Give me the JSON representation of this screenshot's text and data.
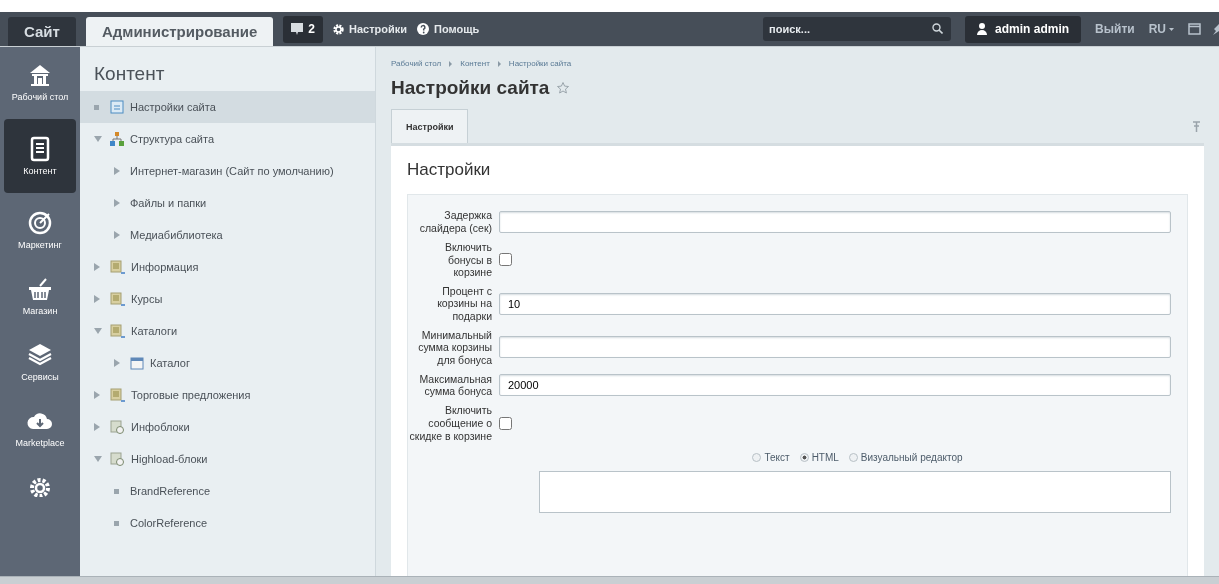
{
  "top_bar": {
    "tabs": [
      {
        "label": "Сайт",
        "selected": false
      },
      {
        "label": "Администрирование",
        "selected": true
      }
    ],
    "notifications": {
      "count": "2"
    },
    "links": [
      "Настройки",
      "Помощь"
    ],
    "search": {
      "placeholder": "поиск..."
    },
    "user": "admin admin",
    "logout": "Выйти",
    "language": "RU"
  },
  "nav": {
    "items": [
      {
        "label": "Рабочий стол",
        "selected": false
      },
      {
        "label": "Контент",
        "selected": true
      },
      {
        "label": "Маркетинг",
        "selected": false
      },
      {
        "label": "Магазин",
        "selected": false
      },
      {
        "label": "Сервисы",
        "selected": false
      },
      {
        "label": "Marketplace",
        "selected": false
      }
    ]
  },
  "tree": {
    "title": "Контент",
    "items": [
      {
        "label": "Настройки сайта",
        "kind": "page",
        "selected": true
      },
      {
        "label": "Структура сайта",
        "kind": "structure",
        "selected": false,
        "expanded": true,
        "children": [
          {
            "label": "Интернет-магазин (Сайт по умолчанию)",
            "kind": "plain",
            "selected": false,
            "expanded": false
          },
          {
            "label": "Файлы и папки",
            "kind": "plain",
            "selected": false,
            "expanded": false
          },
          {
            "label": "Медиабиблиотека",
            "kind": "plain",
            "selected": false,
            "expanded": false
          }
        ]
      },
      {
        "label": "Информация",
        "kind": "section",
        "selected": false,
        "expanded": false
      },
      {
        "label": "Курсы",
        "kind": "section",
        "selected": false,
        "expanded": false
      },
      {
        "label": "Каталоги",
        "kind": "section",
        "selected": false,
        "expanded": true,
        "children": [
          {
            "label": "Каталог",
            "kind": "catalog",
            "selected": false,
            "expanded": false
          }
        ]
      },
      {
        "label": "Торговые предложения",
        "kind": "section",
        "selected": false,
        "expanded": false
      },
      {
        "label": "Инфоблоки",
        "kind": "blocks",
        "selected": false,
        "expanded": false
      },
      {
        "label": "Highload-блоки",
        "kind": "blocks",
        "selected": false,
        "expanded": true,
        "children": [
          {
            "label": "BrandReference",
            "kind": "plain",
            "selected": false
          },
          {
            "label": "ColorReference",
            "kind": "plain",
            "selected": false
          }
        ]
      }
    ]
  },
  "main": {
    "breadcrumbs": [
      "Рабочий стол",
      "Контент",
      "Настройки сайта"
    ],
    "title": "Настройки сайта",
    "tabs": [
      {
        "label": "Настройки",
        "selected": true
      }
    ],
    "section_title": "Настройки",
    "fields": [
      {
        "kind": "text",
        "label": "Задержка слайдера (сек)"
      },
      {
        "kind": "checkbox",
        "label": "Включить бонусы в корзине",
        "checked": false
      },
      {
        "kind": "text",
        "label": "Процент с корзины на подарки",
        "value": "10"
      },
      {
        "kind": "text",
        "label": "Минимальный сумма корзины для бонуса"
      },
      {
        "kind": "text",
        "label": "Максимальная сумма бонуса",
        "value": "20000"
      },
      {
        "kind": "checkbox",
        "label": "Включить сообщение о скидке в корзине",
        "checked": false
      }
    ],
    "editor_modes": [
      {
        "label": "Текст",
        "selected": false
      },
      {
        "label": "HTML",
        "selected": true
      },
      {
        "label": "Визуальный редактор",
        "selected": false
      }
    ]
  }
}
